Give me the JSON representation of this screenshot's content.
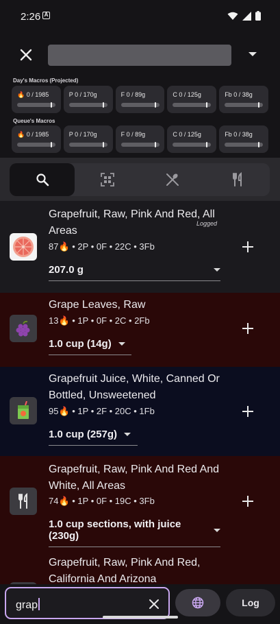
{
  "status_bar": {
    "time": "2:26",
    "notification_badge": "A"
  },
  "top_bar": {
    "title_value": "",
    "icons": [
      "close-icon",
      "chevron-down-icon"
    ]
  },
  "day_macros": {
    "title": "Day's Macros (Projected)",
    "cards": [
      {
        "label": "🔥 0 / 1985",
        "progress": 0
      },
      {
        "label": "P 0 / 170g",
        "progress": 0
      },
      {
        "label": "F 0 / 89g",
        "progress": 0
      },
      {
        "label": "C 0 / 125g",
        "progress": 0
      },
      {
        "label": "Fb 0 / 38g",
        "progress": 0
      }
    ]
  },
  "queue_macros": {
    "title": "Queue's Macros",
    "cards": [
      {
        "label": "🔥 0 / 1985",
        "progress": 0
      },
      {
        "label": "P 0 / 170g",
        "progress": 0
      },
      {
        "label": "F 0 / 89g",
        "progress": 0
      },
      {
        "label": "C 0 / 125g",
        "progress": 0
      },
      {
        "label": "Fb 0 / 38g",
        "progress": 0
      }
    ]
  },
  "tabs": [
    {
      "icon": "search-icon",
      "active": true
    },
    {
      "icon": "barcode-scan-icon",
      "active": false
    },
    {
      "icon": "utensils-crossed-icon",
      "active": false
    },
    {
      "icon": "fork-knife-icon",
      "active": false
    }
  ],
  "results": [
    {
      "name": "Grapefruit, Raw, Pink And Red, All Areas",
      "nutrition": "87🔥 • 2P • 0F • 22C • 3Fb",
      "serving": "207.0 g",
      "status": "Logged",
      "thumb": "grapefruit-image"
    },
    {
      "name": "Grape Leaves, Raw",
      "nutrition": "13🔥 • 1P • 0F • 2C • 2Fb",
      "serving": "1.0 cup (14g)",
      "thumb": "grapes-icon"
    },
    {
      "name": "Grapefruit Juice, White, Canned Or Bottled, Unsweetened",
      "nutrition": "95🔥 • 1P • 2F • 20C • 1Fb",
      "serving": "1.0 cup (257g)",
      "thumb": "juice-box-icon"
    },
    {
      "name": "Grapefruit, Raw, Pink And Red And White, All Areas",
      "nutrition": "74🔥 • 1P • 0F • 19C • 3Fb",
      "serving": "1.0 cup sections, with juice (230g)",
      "thumb": "fork-knife-icon"
    },
    {
      "name": "Grapefruit, Raw, Pink And Red, California And Arizona",
      "thumb": "fork-knife-icon"
    }
  ],
  "bottom_bar": {
    "search_value": "grap",
    "log_label": "Log"
  },
  "colors": {
    "accent": "#c9a7f0",
    "row_dark": "#1b1a1e",
    "row_red": "#2a0808",
    "row_blue": "#0b0d1f"
  }
}
